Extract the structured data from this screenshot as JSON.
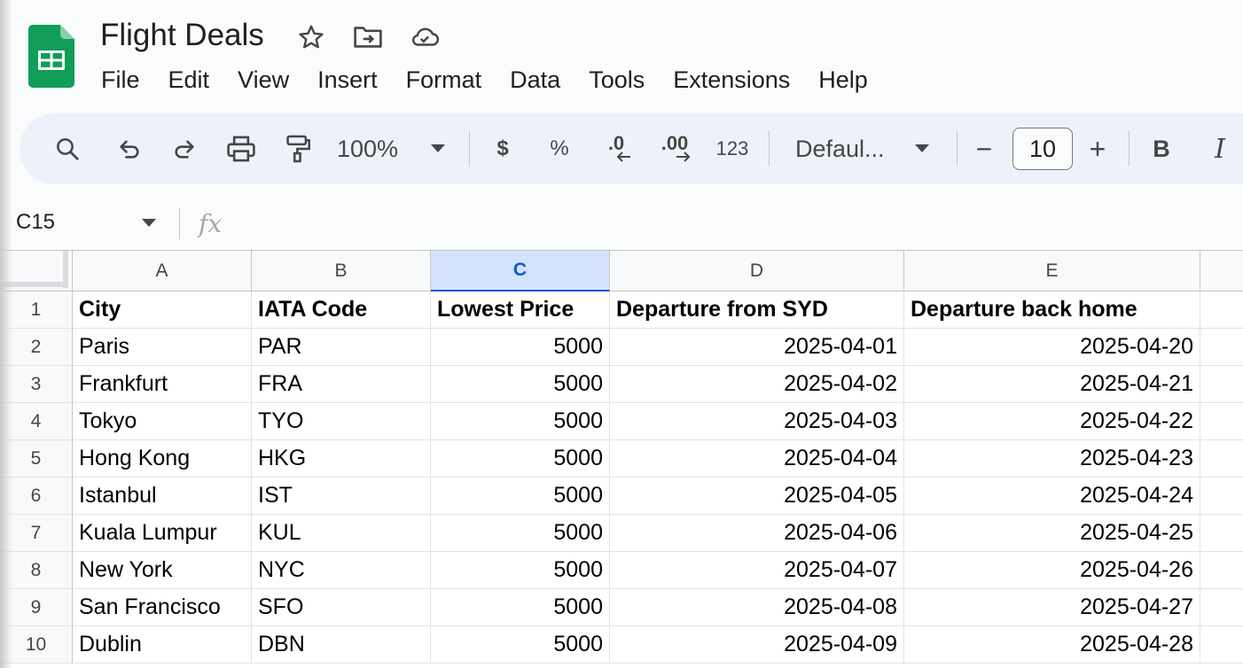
{
  "app": {
    "title": "Flight Deals",
    "accent": "#0b57d0",
    "logo_color": "#0f9d58"
  },
  "menu": [
    "File",
    "Edit",
    "View",
    "Insert",
    "Format",
    "Data",
    "Tools",
    "Extensions",
    "Help"
  ],
  "toolbar": {
    "zoom": "100%",
    "currency": "$",
    "percent": "%",
    "decrease_decimal": ".0",
    "increase_decimal": ".00",
    "number_format": "123",
    "font": "Defaul...",
    "font_size": "10",
    "minus": "−",
    "plus": "+",
    "bold": "B",
    "italic": "I"
  },
  "formula_bar": {
    "name_box": "C15",
    "fx": "fx",
    "value": ""
  },
  "sheet": {
    "columns": [
      "A",
      "B",
      "C",
      "D",
      "E"
    ],
    "selected_column": "C",
    "rows": [
      {
        "num": "1",
        "cells": [
          "City",
          "IATA Code",
          "Lowest Price",
          "Departure from SYD",
          "Departure back home"
        ]
      },
      {
        "num": "2",
        "cells": [
          "Paris",
          "PAR",
          "5000",
          "2025-04-01",
          "2025-04-20"
        ]
      },
      {
        "num": "3",
        "cells": [
          "Frankfurt",
          "FRA",
          "5000",
          "2025-04-02",
          "2025-04-21"
        ]
      },
      {
        "num": "4",
        "cells": [
          "Tokyo",
          "TYO",
          "5000",
          "2025-04-03",
          "2025-04-22"
        ]
      },
      {
        "num": "5",
        "cells": [
          "Hong Kong",
          "HKG",
          "5000",
          "2025-04-04",
          "2025-04-23"
        ]
      },
      {
        "num": "6",
        "cells": [
          "Istanbul",
          "IST",
          "5000",
          "2025-04-05",
          "2025-04-24"
        ]
      },
      {
        "num": "7",
        "cells": [
          "Kuala Lumpur",
          "KUL",
          "5000",
          "2025-04-06",
          "2025-04-25"
        ]
      },
      {
        "num": "8",
        "cells": [
          "New York",
          "NYC",
          "5000",
          "2025-04-07",
          "2025-04-26"
        ]
      },
      {
        "num": "9",
        "cells": [
          "San Francisco",
          "SFO",
          "5000",
          "2025-04-08",
          "2025-04-27"
        ]
      },
      {
        "num": "10",
        "cells": [
          "Dublin",
          "DBN",
          "5000",
          "2025-04-09",
          "2025-04-28"
        ]
      }
    ]
  }
}
